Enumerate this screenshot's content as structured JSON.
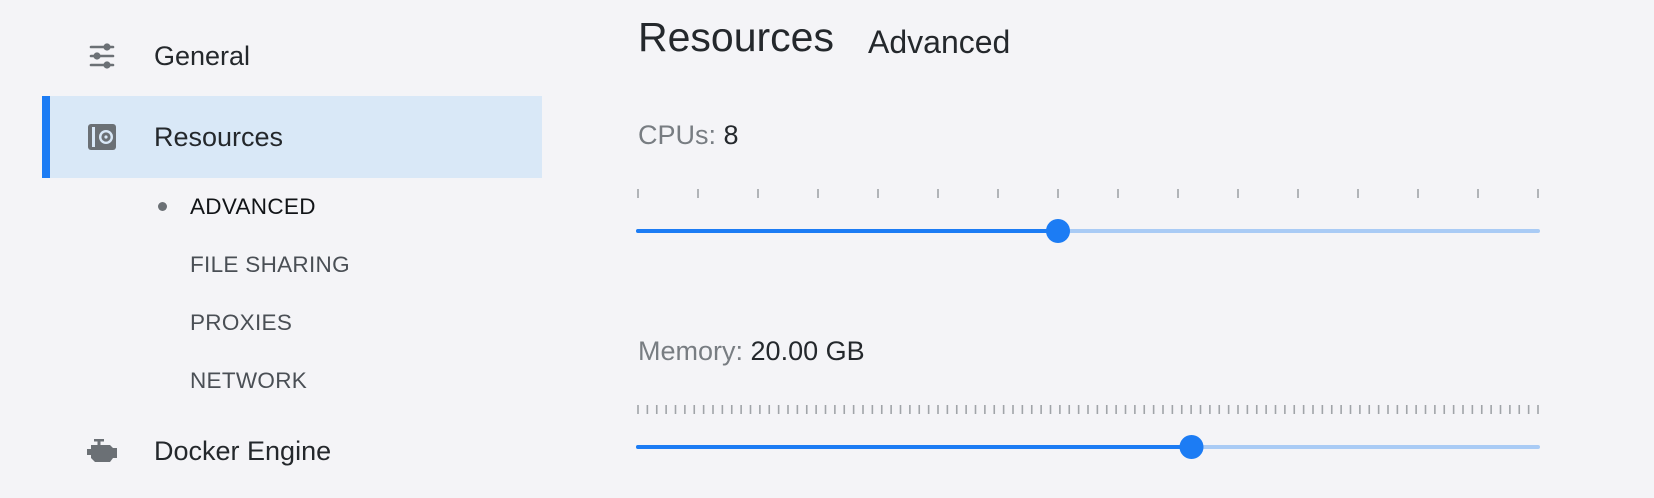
{
  "sidebar": {
    "items": [
      {
        "label": "General",
        "icon": "sliders-icon"
      },
      {
        "label": "Resources",
        "icon": "resources-icon",
        "active": true
      },
      {
        "label": "Docker Engine",
        "icon": "engine-icon"
      }
    ],
    "subitems": [
      {
        "label": "ADVANCED",
        "selected": true
      },
      {
        "label": "FILE SHARING"
      },
      {
        "label": "PROXIES"
      },
      {
        "label": "NETWORK"
      }
    ]
  },
  "main": {
    "title": "Resources",
    "subtitle": "Advanced",
    "cpu": {
      "label": "CPUs:",
      "value": "8",
      "min": 1,
      "max": 16,
      "current": 8,
      "ticks": 16
    },
    "memory": {
      "label": "Memory:",
      "value": "20.00 GB",
      "current_fraction": 0.615,
      "ticks": 97
    }
  },
  "colors": {
    "accent": "#1c7cf4",
    "track_inactive": "#a9cbf5",
    "active_bg": "#d9e8f7",
    "tick": "#a0a4a8"
  }
}
